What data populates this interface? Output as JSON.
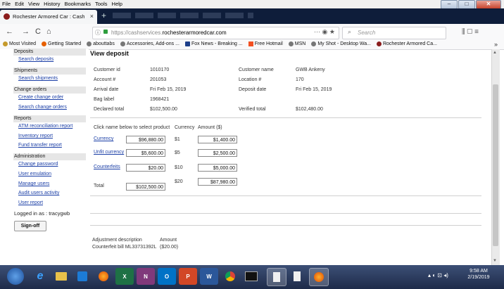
{
  "menubar": {
    "items": [
      "File",
      "Edit",
      "View",
      "History",
      "Bookmarks",
      "Tools",
      "Help"
    ]
  },
  "window_controls": {
    "minimize": "–",
    "maximize": "□",
    "close": "✕"
  },
  "tab": {
    "title": "Rochester Armored Car : Cash",
    "close": "×",
    "new_tab": "+"
  },
  "nav": {
    "back": "←",
    "forward": "→",
    "reload": "C",
    "home": "⌂",
    "url_prefix": "https://cashservices.",
    "url_domain": "rochesterarmoredcar.com",
    "url_actions": "··· ◉ ★",
    "search_placeholder": "Search",
    "right_icons": "⫼ ▢ ≡"
  },
  "bookmarks": [
    "Most Visited",
    "Getting Started",
    "abouttabs",
    "Accessories, Add-ons ...",
    "Fox News - Breaking ...",
    "Free Hotmail",
    "MSN",
    "My Shot - Desktop Wa...",
    "Rochester Armored Ca..."
  ],
  "bookmarks_more": "»",
  "sidebar": {
    "sections": [
      {
        "header": "Deposits",
        "links": [
          "Search deposits"
        ]
      },
      {
        "header": "Shipments",
        "links": [
          "Search shipments"
        ]
      },
      {
        "header": "Change orders",
        "links": [
          "Create change order",
          "Search change orders"
        ]
      },
      {
        "header": "Reports",
        "links": [
          "ATM reconciliation report",
          "Inventory report",
          "Fund transfer report"
        ]
      },
      {
        "header": "Administration",
        "links": [
          "Change password",
          "User emulation",
          "Manage users",
          "Audit users activity",
          "User report"
        ]
      }
    ],
    "logged_in": "Logged in as : tracygwb",
    "signoff": "Sign-off"
  },
  "deposit": {
    "title": "View deposit",
    "customer_id_label": "Customer id",
    "customer_id": "1010170",
    "customer_name_label": "Customer name",
    "customer_name": "GWB Ankeny",
    "account_label": "Account #",
    "account": "201053",
    "location_label": "Location #",
    "location": "170",
    "arrival_label": "Arrival date",
    "arrival": "Fri Feb 15, 2019",
    "deposit_date_label": "Deposit date",
    "deposit_date": "Fri Feb 15, 2019",
    "bag_label_label": "Bag label",
    "bag_label": "1968421",
    "declared_label": "Declared total",
    "declared": "$102,500.00",
    "verified_label": "Verified total",
    "verified": "$102,480.00"
  },
  "products": {
    "header_product": "Click name below to select product",
    "header_currency": "Currency",
    "header_amount": "Amount ($)",
    "rows": [
      {
        "name": "Currency",
        "value": "$96,880.00",
        "denom": "$1",
        "amount": "$1,400.00"
      },
      {
        "name": "Unfit currency",
        "value": "$5,600.00",
        "denom": "$5",
        "amount": "$2,500.00"
      },
      {
        "name": "Counterfeits",
        "value": "$20.00",
        "denom": "$10",
        "amount": "$5,000.00"
      }
    ],
    "extra_denom": "$20",
    "extra_amount": "$87,980.00",
    "total_label": "Total",
    "total": "$102,500.00"
  },
  "adjustment": {
    "desc_label": "Adjustment description",
    "amount_label": "Amount",
    "desc": "Counterfeit bill ML33731392L",
    "amount": "($20.00)"
  },
  "taskbar": {
    "apps": [
      "e",
      "",
      "",
      "",
      "X",
      "N",
      "O",
      "P",
      "W",
      "",
      "",
      "",
      "",
      ""
    ],
    "tray": "▴ ◐ ⊡ ◂)",
    "time": "9:58 AM",
    "date": "2/19/2019"
  }
}
